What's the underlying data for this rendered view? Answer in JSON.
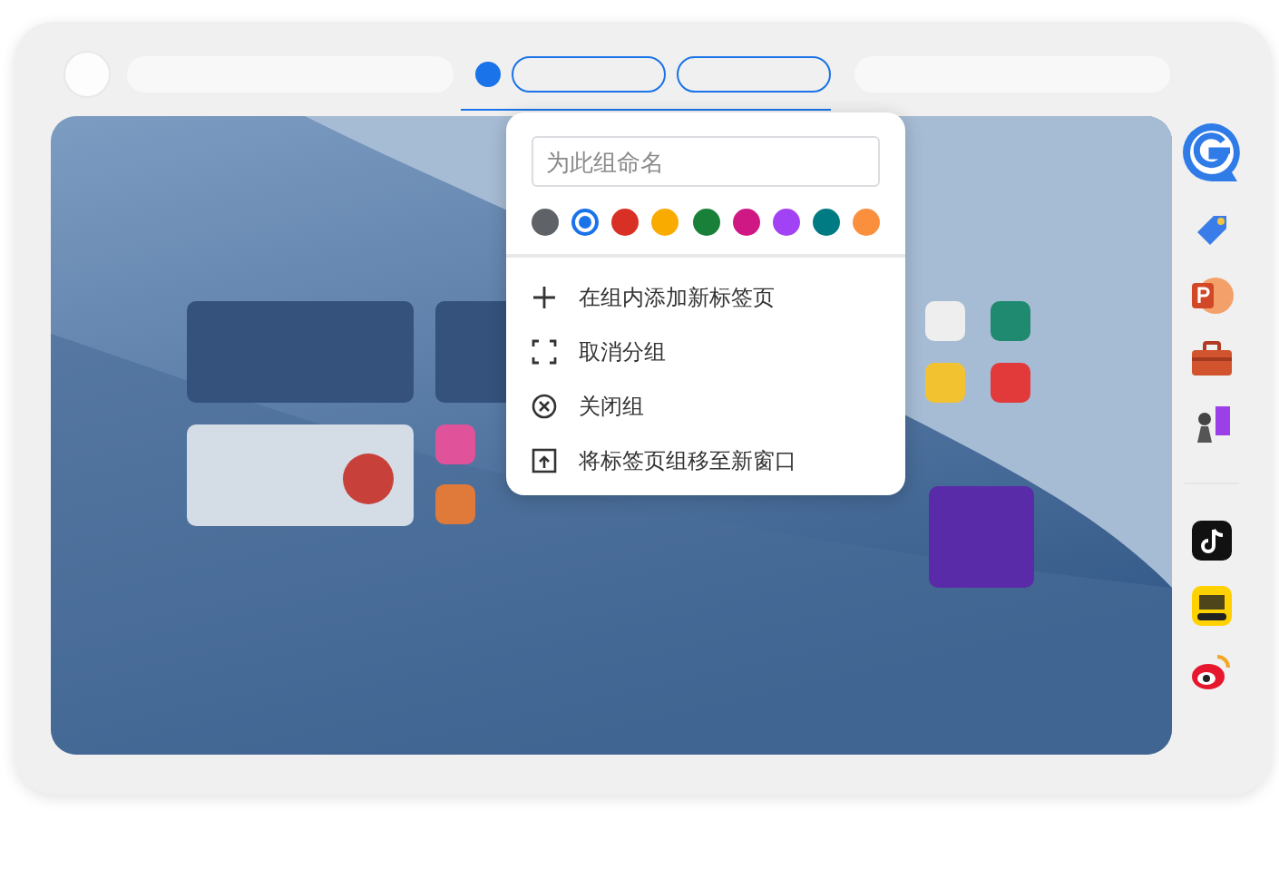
{
  "group_menu": {
    "name_field": {
      "placeholder": "为此组命名"
    },
    "colors": [
      {
        "color": "#5f6368",
        "selected": false
      },
      {
        "color": "#1a73e8",
        "selected": true
      },
      {
        "color": "#d93025",
        "selected": false
      },
      {
        "color": "#f9ab00",
        "selected": false
      },
      {
        "color": "#188038",
        "selected": false
      },
      {
        "color": "#d01884",
        "selected": false
      },
      {
        "color": "#a142f4",
        "selected": false
      },
      {
        "color": "#007b83",
        "selected": false
      },
      {
        "color": "#fa903e",
        "selected": false
      }
    ],
    "items": [
      {
        "kind": "add",
        "label": "在组内添加新标签页"
      },
      {
        "kind": "ungroup",
        "label": "取消分组"
      },
      {
        "kind": "close",
        "label": "关闭组"
      },
      {
        "kind": "move",
        "label": "将标签页组移至新窗口"
      }
    ]
  }
}
